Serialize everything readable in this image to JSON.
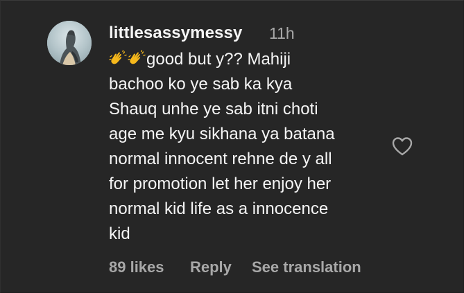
{
  "comment": {
    "username": "littlesassymessy",
    "timestamp": "11h",
    "emoji_prefix": "👏👏",
    "text_lines": [
      "good but y?? Mahiji",
      "bachoo ko ye sab ka kya",
      "Shauq unhe ye sab itni choti",
      "age me kyu sikhana ya batana",
      "normal innocent rehne de y all",
      "for promotion let her enjoy her",
      "normal kid life as a innocence",
      "kid"
    ],
    "likes": "89 likes",
    "reply_label": "Reply",
    "translate_label": "See translation"
  },
  "icons": {
    "avatar": "profile-avatar",
    "like": "heart-outline-icon",
    "emoji": "clapping-hands-emoji"
  },
  "colors": {
    "background": "#262626",
    "primary_text": "#f5f5f5",
    "secondary_text": "#a8a8a8",
    "emoji_yellow": "#f5b81c"
  }
}
